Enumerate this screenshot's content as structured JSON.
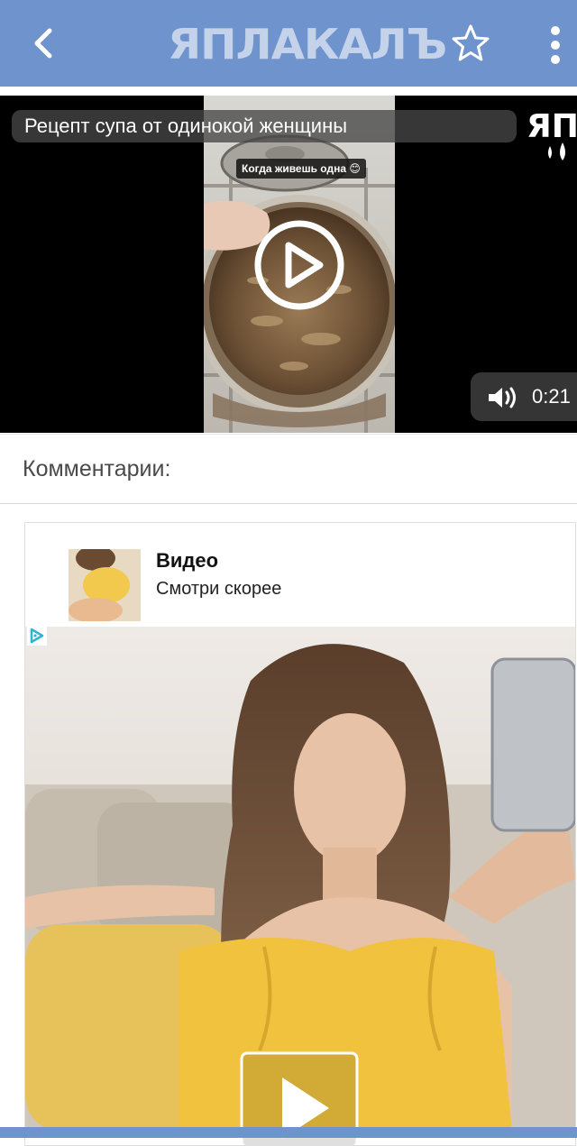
{
  "topbar": {
    "logo_text": "ЯПЛАКАЛЪ",
    "back_icon": "chevron-left-icon",
    "star_icon": "star-outline-icon",
    "menu_icon": "more-vertical-icon",
    "background_color": "#6f93cc"
  },
  "video": {
    "title": "Рецепт супа от одинокой женщины",
    "frame_caption": "Когда живешь одна 😊",
    "duration": "0:21",
    "watermark_text": "ЯП",
    "play_icon": "play-circle-icon",
    "volume_icon": "volume-icon"
  },
  "comments": {
    "title": "Комментарии:"
  },
  "ad": {
    "title": "Видео",
    "subtitle": "Смотри скорее",
    "choices_icon": "adchoices-icon",
    "play_icon": "play-icon"
  }
}
